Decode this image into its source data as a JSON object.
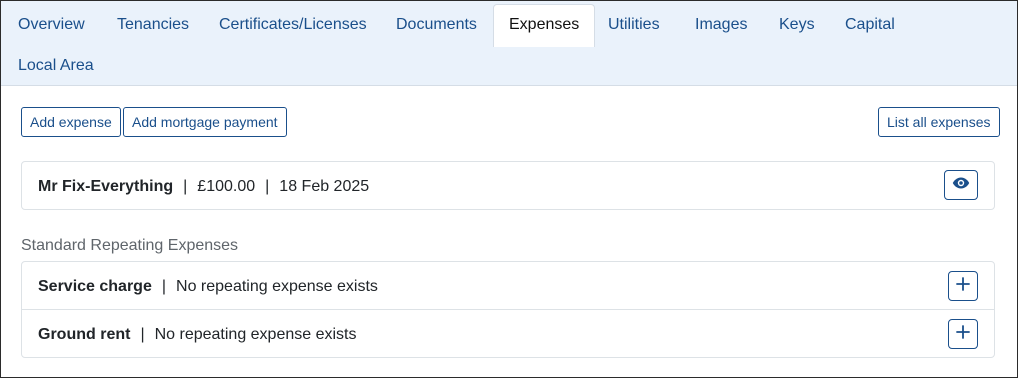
{
  "tabs": [
    {
      "label": "Overview"
    },
    {
      "label": "Tenancies"
    },
    {
      "label": "Certificates/Licenses"
    },
    {
      "label": "Documents"
    },
    {
      "label": "Expenses",
      "active": true
    },
    {
      "label": "Utilities"
    },
    {
      "label": "Images"
    },
    {
      "label": "Keys"
    },
    {
      "label": "Capital"
    },
    {
      "label": "Local Area"
    }
  ],
  "toolbar": {
    "add_expense_label": "Add expense",
    "add_mortgage_label": "Add mortgage payment",
    "list_all_label": "List all expenses"
  },
  "expense": {
    "payee": "Mr Fix-Everything",
    "separator": "|",
    "amount": "£100.00",
    "date": "18 Feb 2025",
    "view_icon": "eye-icon"
  },
  "repeating": {
    "heading": "Standard Repeating Expenses",
    "items": [
      {
        "name": "Service charge",
        "status": "No repeating expense exists",
        "action_icon": "plus-icon"
      },
      {
        "name": "Ground rent",
        "status": "No repeating expense exists",
        "action_icon": "plus-icon"
      }
    ]
  },
  "colors": {
    "accent": "#1a4f8b",
    "tabbar_bg": "#eaf2fb",
    "muted_text": "#5f656b"
  }
}
